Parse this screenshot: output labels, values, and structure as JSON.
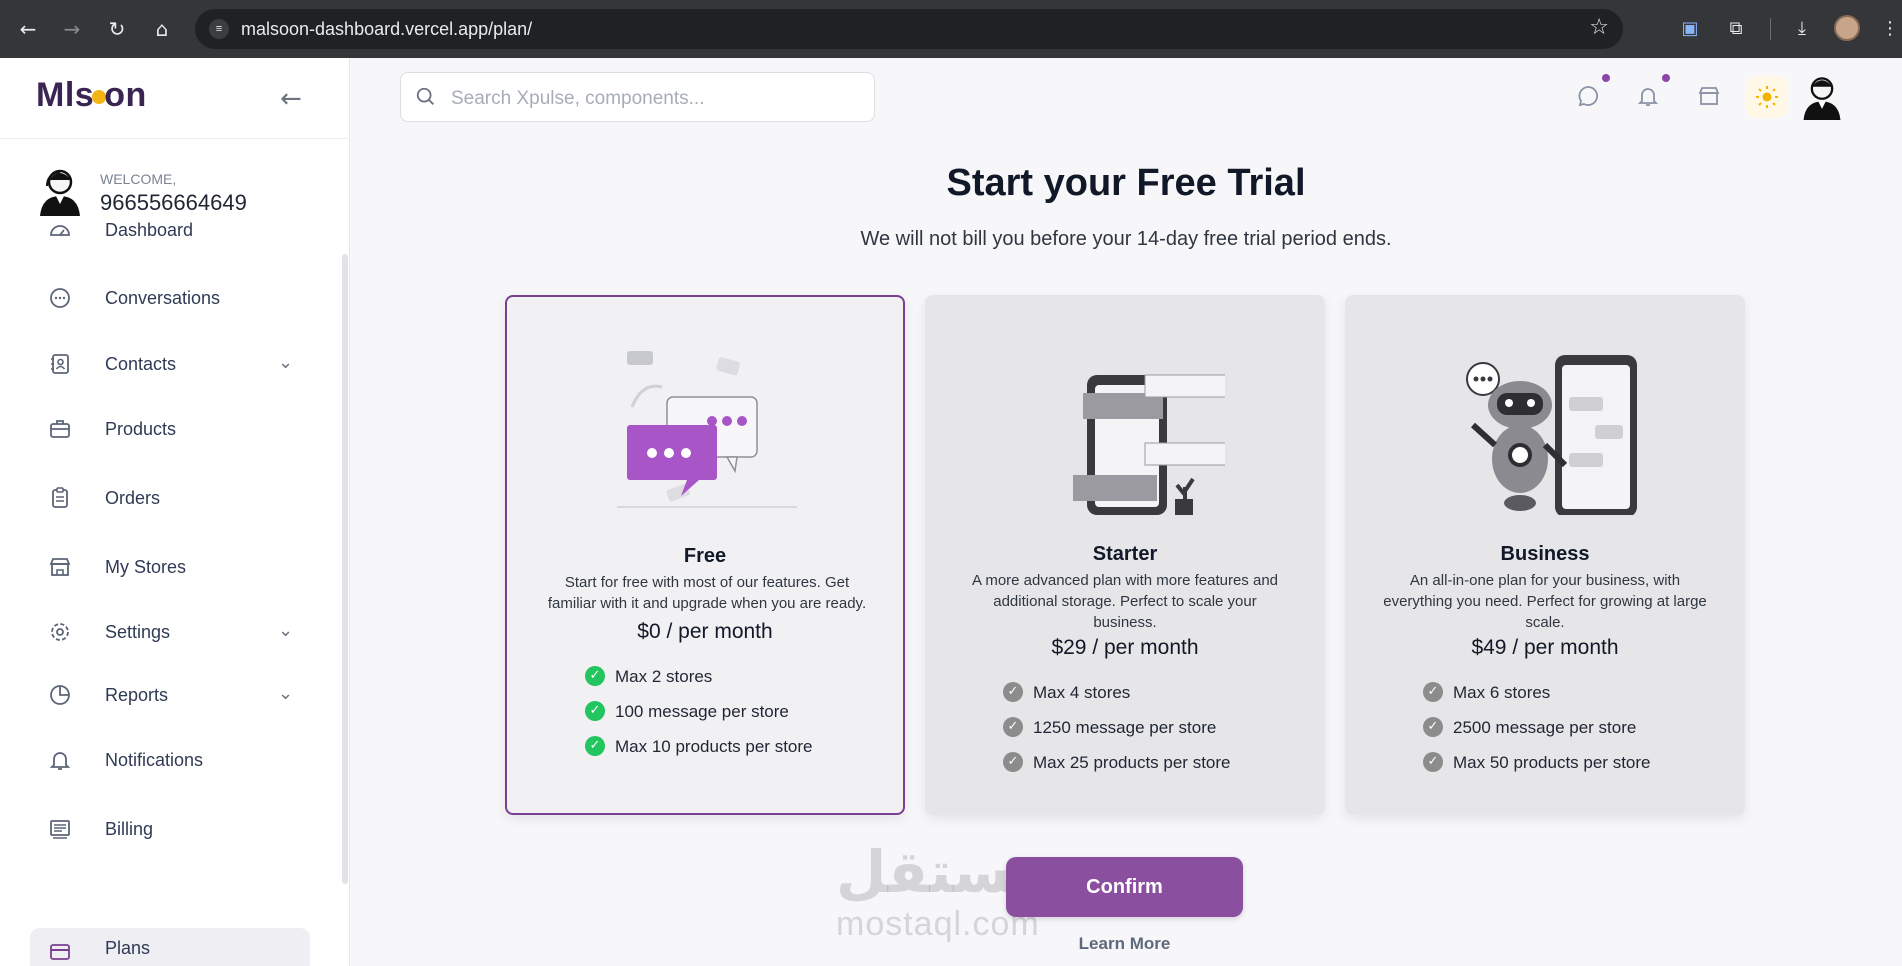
{
  "browser": {
    "url": "malsoon-dashboard.vercel.app/plan/"
  },
  "sidebar": {
    "logo_text_left": "Mls",
    "logo_text_right": "on",
    "welcome_label": "WELCOME,",
    "username": "966556664649",
    "items": [
      {
        "label": "Dashboard",
        "icon": "dashboard-icon",
        "expandable": false
      },
      {
        "label": "Conversations",
        "icon": "chat-icon",
        "expandable": false
      },
      {
        "label": "Contacts",
        "icon": "contacts-icon",
        "expandable": true
      },
      {
        "label": "Products",
        "icon": "briefcase-icon",
        "expandable": false
      },
      {
        "label": "Orders",
        "icon": "clipboard-icon",
        "expandable": false
      },
      {
        "label": "My Stores",
        "icon": "store-icon",
        "expandable": false
      },
      {
        "label": "Settings",
        "icon": "gear-icon",
        "expandable": true
      },
      {
        "label": "Reports",
        "icon": "pie-chart-icon",
        "expandable": true
      },
      {
        "label": "Notifications",
        "icon": "bell-icon",
        "expandable": false
      },
      {
        "label": "Billing",
        "icon": "billing-icon",
        "expandable": false
      },
      {
        "label": "Plans",
        "icon": "card-icon",
        "expandable": false,
        "active": true
      }
    ]
  },
  "topbar": {
    "search_placeholder": "Search Xpulse, components..."
  },
  "main": {
    "title": "Start your Free Trial",
    "subtitle": "We will not bill you before your 14-day free trial period ends.",
    "plans": [
      {
        "name": "Free",
        "description": "Start for free with most of our features. Get familiar with it and upgrade when you are ready.",
        "price": "$0 / per month",
        "selected": true,
        "features": [
          "Max 2 stores",
          "100 message per store",
          "Max 10 products per store"
        ]
      },
      {
        "name": "Starter",
        "description": "A more advanced plan with more features and additional storage. Perfect to scale your business.",
        "price": "$29 / per month",
        "selected": false,
        "features": [
          "Max 4 stores",
          "1250 message per store",
          "Max 25 products per store"
        ]
      },
      {
        "name": "Business",
        "description": "An all-in-one plan for your business, with everything you need. Perfect for growing at large scale.",
        "price": "$49 / per month",
        "selected": false,
        "features": [
          "Max 6 stores",
          "2500 message per store",
          "Max 50 products per store"
        ]
      }
    ],
    "confirm_label": "Confirm",
    "learn_more_label": "Learn More"
  },
  "watermark": {
    "arabic": "مستقل",
    "latin": "mostaql.com"
  },
  "colors": {
    "brand": "#8b4f9f",
    "selected_border": "#7a3f93",
    "check_active": "#22c55e",
    "check_inactive": "#8c8c8c",
    "badge": "#8e44ad"
  }
}
